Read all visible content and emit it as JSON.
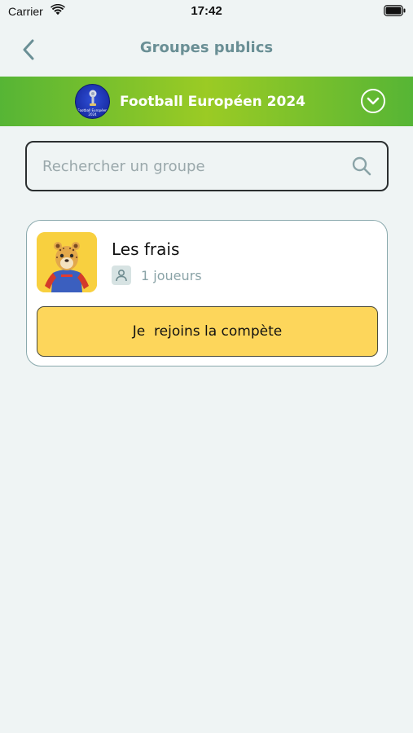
{
  "status_bar": {
    "carrier": "Carrier",
    "time": "17:42",
    "icons": [
      "wifi-icon",
      "battery-icon"
    ]
  },
  "nav": {
    "title": "Groupes publics",
    "back_icon": "chevron-left-icon"
  },
  "competition": {
    "name": "Football Européen 2024",
    "logo_text": "Football Européen 2024",
    "toggle_icon": "chevron-down-circle-icon"
  },
  "search": {
    "placeholder": "Rechercher un groupe",
    "value": "",
    "icon": "search-icon"
  },
  "groups": [
    {
      "name": "Les frais",
      "members": "1 joueurs",
      "members_icon": "user-icon",
      "avatar": "cheetah-mascot-avatar",
      "join_label": "Je  rejoins la compète"
    }
  ],
  "colors": {
    "background": "#eff4f4",
    "banner_green": "#56b535",
    "banner_lime": "#9bcb24",
    "title_gray": "#6a8f95",
    "join_yellow": "#fdd65b",
    "card_border": "#8aa9ad"
  }
}
